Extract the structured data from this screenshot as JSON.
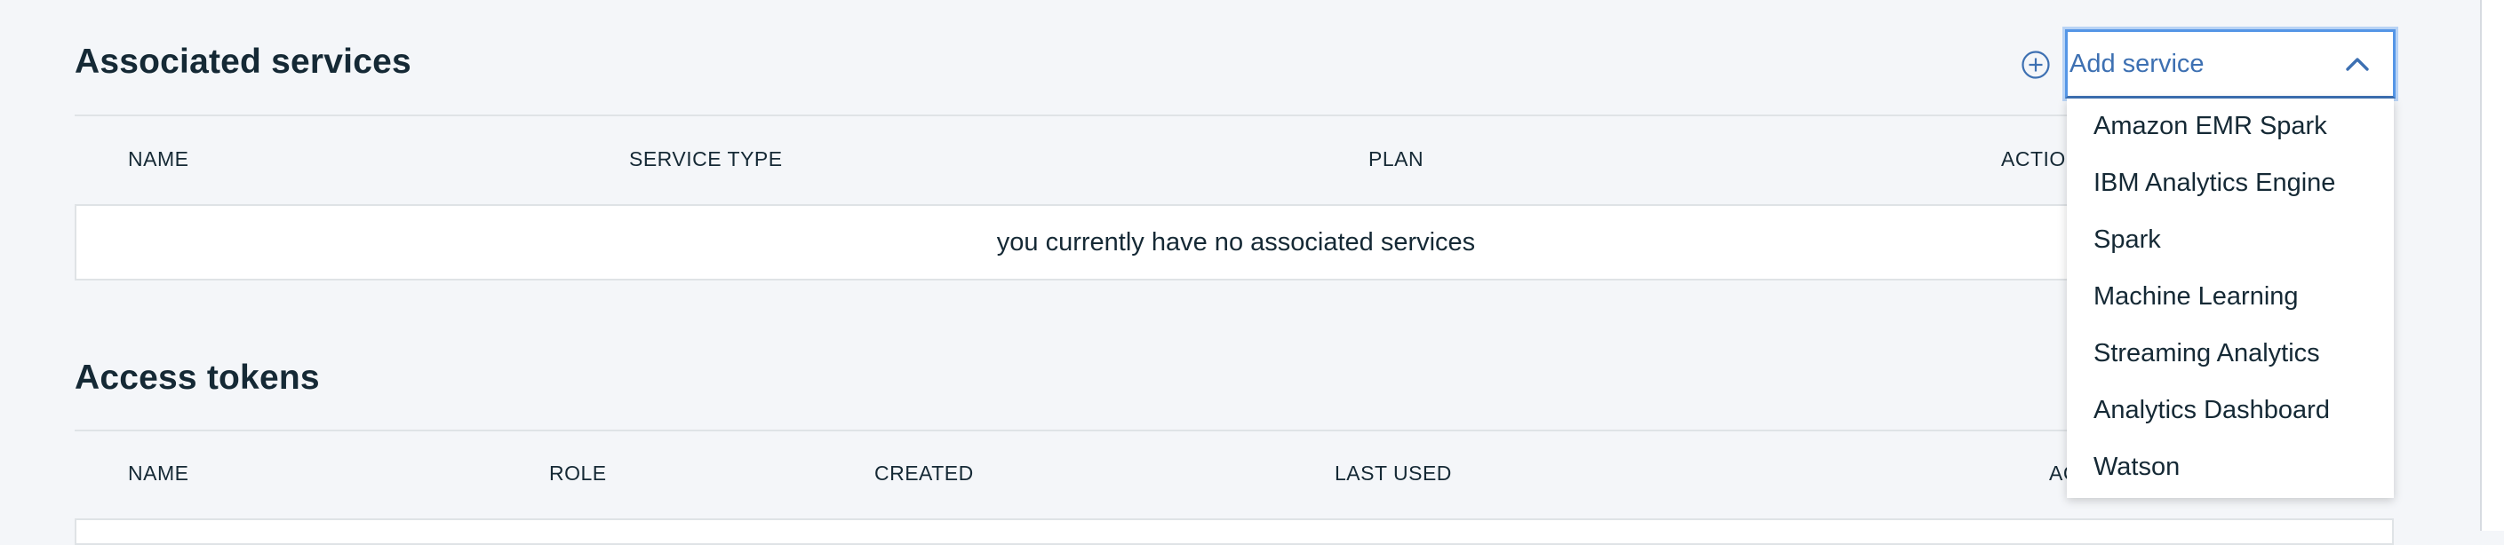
{
  "services": {
    "title": "Associated services",
    "columns": {
      "name": "NAME",
      "service_type": "SERVICE TYPE",
      "plan": "PLAN",
      "actions": "ACTIONS"
    },
    "empty_message": "you currently have no associated services"
  },
  "tokens": {
    "title": "Access tokens",
    "columns": {
      "name": "NAME",
      "role": "ROLE",
      "created": "CREATED",
      "last_used": "LAST USED",
      "actions": "ACTIONS"
    }
  },
  "add_service": {
    "label": "Add service",
    "icon": "add-circle-icon",
    "expanded": true,
    "options": [
      "Amazon EMR Spark",
      "IBM Analytics Engine",
      "Spark",
      "Machine Learning",
      "Streaming Analytics",
      "Analytics Dashboard",
      "Watson"
    ]
  },
  "colors": {
    "accent": "#3d70b2",
    "focus_ring": "#5596e6",
    "background": "#f4f6f9",
    "text": "#152935"
  }
}
